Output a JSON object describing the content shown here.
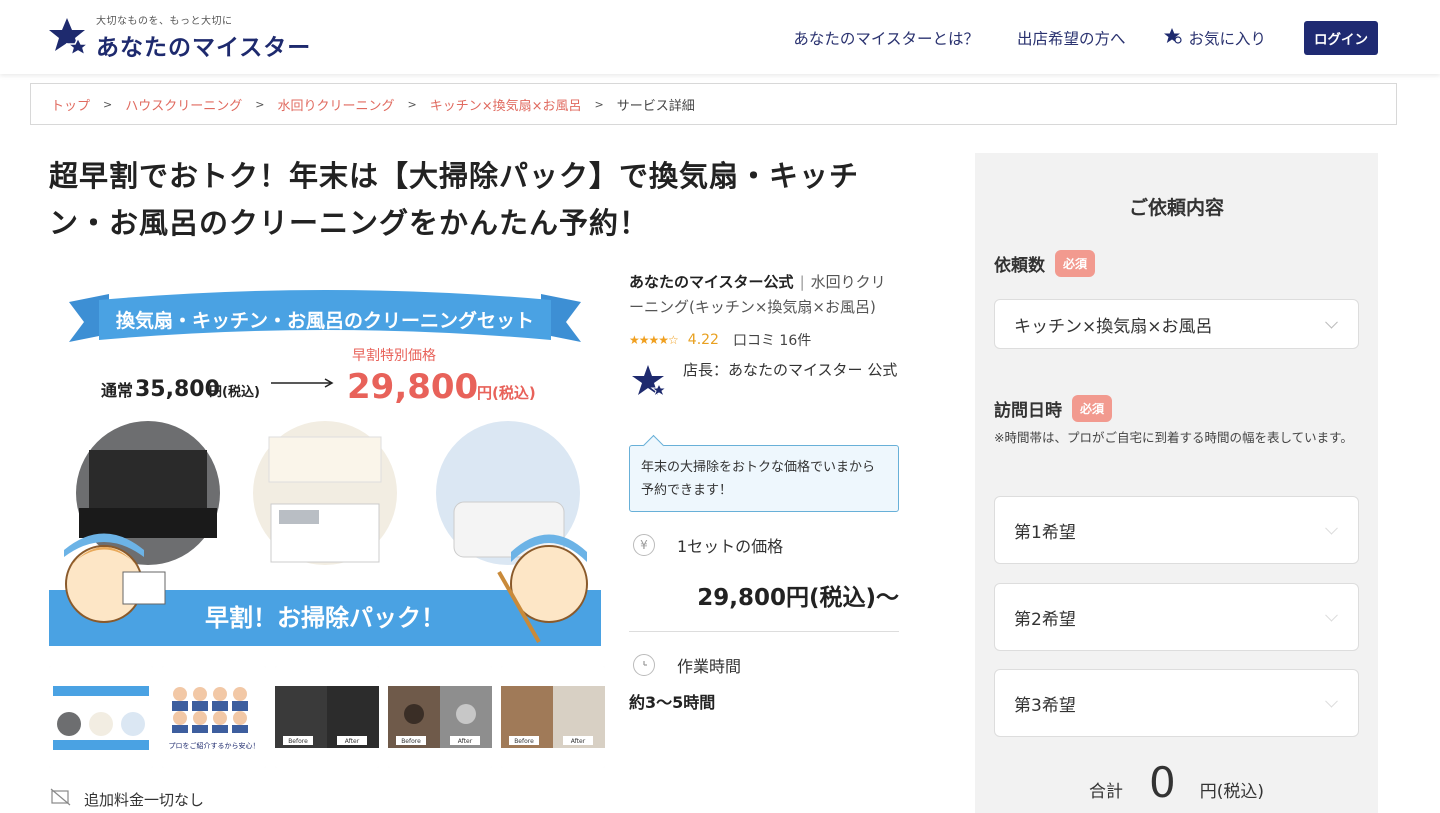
{
  "header": {
    "tagline": "大切なものを、もっと大切に",
    "logo_name": "あなたのマイスター",
    "nav": {
      "about": "あなたのマイスターとは？",
      "vendors": "出店希望の方へ",
      "favorites": "お気に入り",
      "login": "ログイン"
    },
    "brand_color": "#1e2a6e"
  },
  "breadcrumb": {
    "items": [
      "トップ",
      "ハウスクリーニング",
      "水回りクリーニング",
      "キッチン×換気扇×お風呂"
    ],
    "current": "サービス詳細",
    "separator": ">"
  },
  "title": "超早割でおトク！年末は【大掃除パック】で換気扇・キッチン・お風呂のクリーニングをかんたん予約！",
  "hero": {
    "banner": "換気扇・キッチン・お風呂のクリーニングセット",
    "price_label": "早割特別価格",
    "regular_label": "通常",
    "regular_price": "35,800",
    "regular_unit": "円(税込)",
    "special_price": "29,800",
    "special_unit": "円(税込)",
    "footer_banner": "早割！お掃除パック！"
  },
  "thumbnails": [
    {
      "name": "thumb-set"
    },
    {
      "name": "thumb-staff",
      "caption": "プロをご紹介するから安心！"
    },
    {
      "name": "thumb-hood",
      "before": "Before",
      "after": "After"
    },
    {
      "name": "thumb-sink",
      "before": "Before",
      "after": "After"
    },
    {
      "name": "thumb-kitchen",
      "before": "Before",
      "after": "After"
    }
  ],
  "extra_fee": "追加料金一切なし",
  "vendor": {
    "name": "あなたのマイスター公式",
    "category": "水回りクリーニング(キッチン×換気扇×お風呂)",
    "rating": "4.22",
    "rating_value": 4.22,
    "reviews": "口コミ 16件",
    "owner": "店長：あなたのマイスター 公式",
    "message": "年末の大掃除をおトクな価格でいまから予約できます！"
  },
  "pricing": {
    "label": "1セットの価格",
    "value": "29,800円(税込)〜",
    "time_label": "作業時間",
    "time_value": "約3〜5時間"
  },
  "panel": {
    "title": "ご依頼内容",
    "count_label": "依頼数",
    "required": "必須",
    "count_value": "キッチン×換気扇×お風呂",
    "visit_label": "訪問日時",
    "visit_note": "※時間帯は、プロがご自宅に到着する時間の幅を表しています。",
    "pref1": "第1希望",
    "pref2": "第2希望",
    "pref3": "第3希望",
    "total_label": "合計",
    "total_value": "0",
    "total_unit": "円(税込)"
  }
}
